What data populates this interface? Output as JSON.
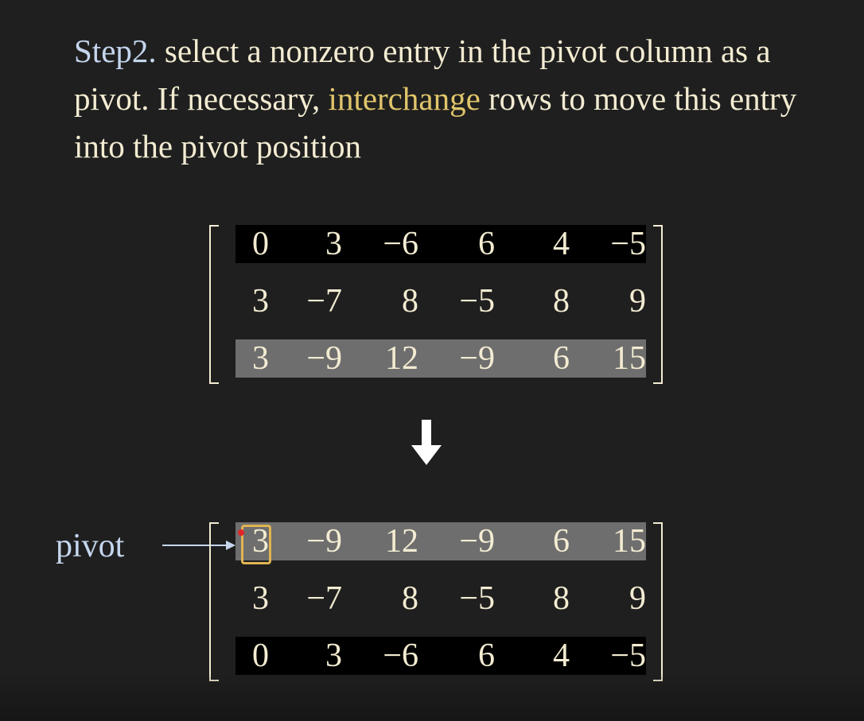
{
  "heading": {
    "step": "Step2.",
    "part1": " select a nonzero entry in the pivot column as a pivot. If necessary, ",
    "highlight": "interchange",
    "part2": " rows to move this entry into the pivot position"
  },
  "matrix_before": [
    [
      "0",
      "3",
      "−6",
      "6",
      "4",
      "−5"
    ],
    [
      "3",
      "−7",
      "8",
      "−5",
      "8",
      "9"
    ],
    [
      "3",
      "−9",
      "12",
      "−9",
      "6",
      "15"
    ]
  ],
  "matrix_after": [
    [
      "3",
      "−9",
      "12",
      "−9",
      "6",
      "15"
    ],
    [
      "3",
      "−7",
      "8",
      "−5",
      "8",
      "9"
    ],
    [
      "0",
      "3",
      "−6",
      "6",
      "4",
      "−5"
    ]
  ],
  "pivot_label": "pivot",
  "icons": {
    "transition": "down-arrow-icon",
    "pointer": "right-arrow-icon"
  },
  "colors": {
    "background": "#1f1f1f",
    "text": "#f3ecd2",
    "step_label": "#c5d6ee",
    "highlight_word": "#e0c56a",
    "pivot_box": "#e0b552",
    "row_black": "#000000",
    "row_gray": "#6e6e6e"
  }
}
